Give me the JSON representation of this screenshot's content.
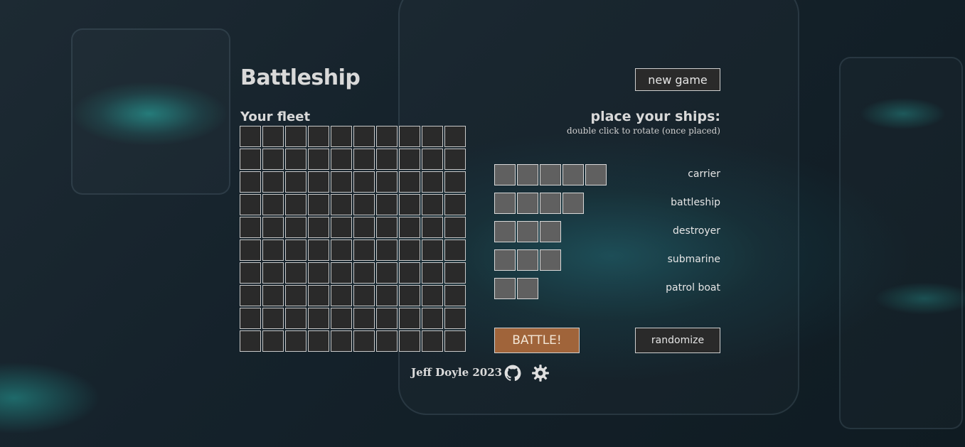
{
  "app": {
    "title": "Battleship",
    "new_game_label": "new game"
  },
  "fleet": {
    "label": "Your fleet",
    "grid_rows": 10,
    "grid_cols": 10
  },
  "placement": {
    "heading": "place your ships:",
    "hint": "double click to rotate (once placed)",
    "ships": [
      {
        "name": "carrier",
        "length": 5
      },
      {
        "name": "battleship",
        "length": 4
      },
      {
        "name": "destroyer",
        "length": 3
      },
      {
        "name": "submarine",
        "length": 3
      },
      {
        "name": "patrol boat",
        "length": 2
      }
    ]
  },
  "actions": {
    "battle_label": "BATTLE!",
    "randomize_label": "randomize"
  },
  "footer": {
    "credit": "Jeff Doyle 2023",
    "icons": [
      "github-icon",
      "settings-gear-icon"
    ]
  },
  "colors": {
    "battle_button": "#a0643a",
    "ship_cell": "#606060",
    "grid_cell": "#2a2a2a"
  }
}
